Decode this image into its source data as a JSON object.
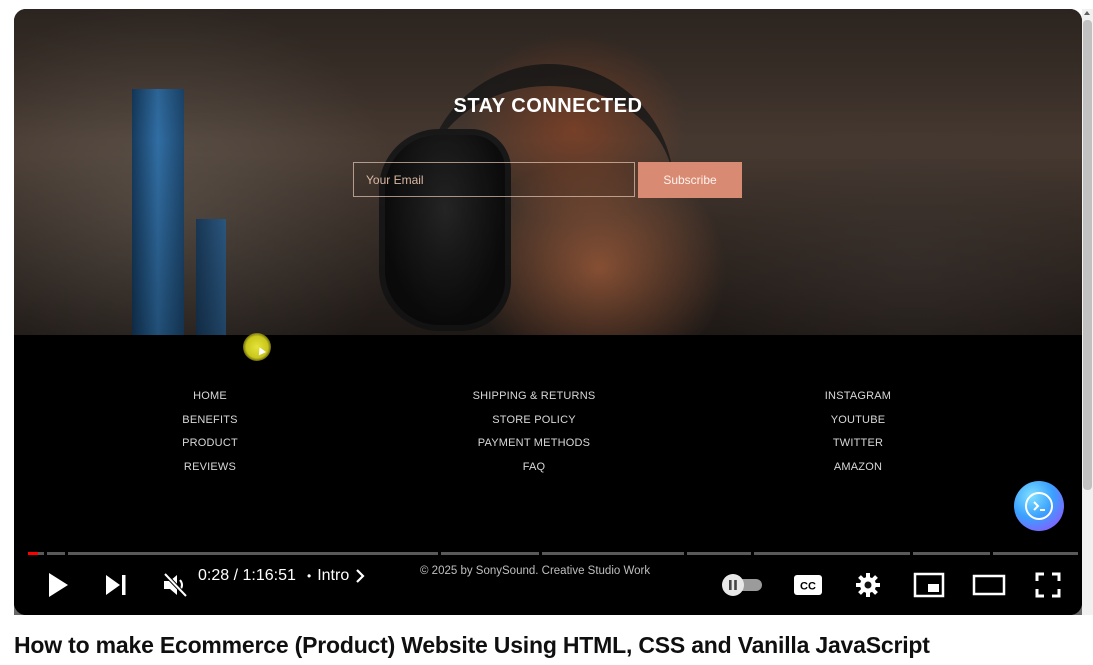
{
  "video": {
    "title": "How to make Ecommerce (Product) Website Using HTML, CSS and Vanilla JavaScript"
  },
  "website": {
    "newsletter": {
      "heading": "STAY CONNECTED",
      "email_placeholder": "Your Email",
      "subscribe_label": "Subscribe"
    },
    "footer": {
      "col1": [
        "HOME",
        "BENEFITS",
        "PRODUCT",
        "REVIEWS"
      ],
      "col2": [
        "SHIPPING & RETURNS",
        "STORE POLICY",
        "PAYMENT METHODS",
        "FAQ"
      ],
      "col3": [
        "INSTAGRAM",
        "YOUTUBE",
        "TWITTER",
        "AMAZON"
      ],
      "copyright": "© 2025 by SonySound. Creative Studio Work"
    }
  },
  "player": {
    "time": "0:28 / 1:16:51",
    "chapter_separator": "•",
    "chapter": "Intro",
    "progress_fraction": 0.006,
    "icons": {
      "play": "play-icon",
      "next": "next-icon",
      "mute": "volume-muted-icon",
      "chapter_arrow": "chevron-right-icon",
      "autoplay": "autoplay-toggle-icon",
      "captions": "cc-icon",
      "settings": "gear-icon",
      "miniplayer": "miniplayer-icon",
      "theater": "theater-mode-icon",
      "fullscreen": "fullscreen-icon",
      "extension": "terminal-extension-icon"
    },
    "colors": {
      "progress_played": "#ff0000",
      "subscribe_button": "#d98a72"
    }
  }
}
